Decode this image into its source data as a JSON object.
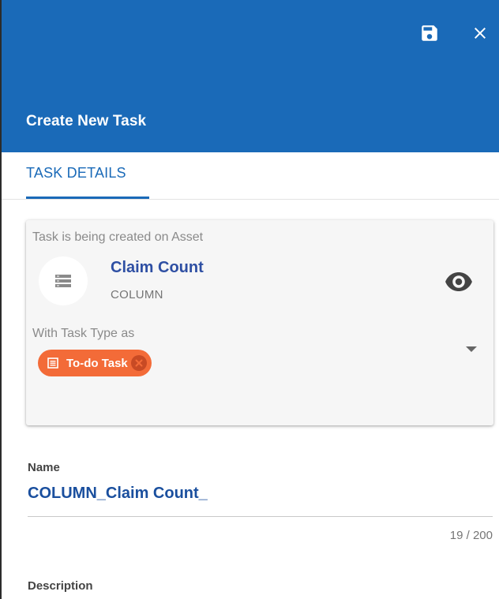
{
  "header": {
    "title": "Create New Task",
    "color": "#1a6ab8",
    "save_icon": "save-icon",
    "close_icon": "close-icon"
  },
  "tabs": [
    {
      "label": "TASK DETAILS",
      "active": true
    }
  ],
  "asset_card": {
    "label": "Task is being created on Asset",
    "asset_icon": "table-rows-icon",
    "asset_name": "Claim Count",
    "asset_type": "COLUMN",
    "view_icon": "eye-icon",
    "task_type_label": "With Task Type as",
    "task_type_chip": {
      "label": "To-do Task",
      "color": "#f36b38",
      "icon": "list-icon",
      "remove_icon": "close-circle-icon"
    },
    "dropdown_icon": "chevron-down-icon"
  },
  "name_field": {
    "label": "Name",
    "value": "COLUMN_Claim Count_",
    "counter": "19 / 200"
  },
  "description_field": {
    "label": "Description"
  }
}
